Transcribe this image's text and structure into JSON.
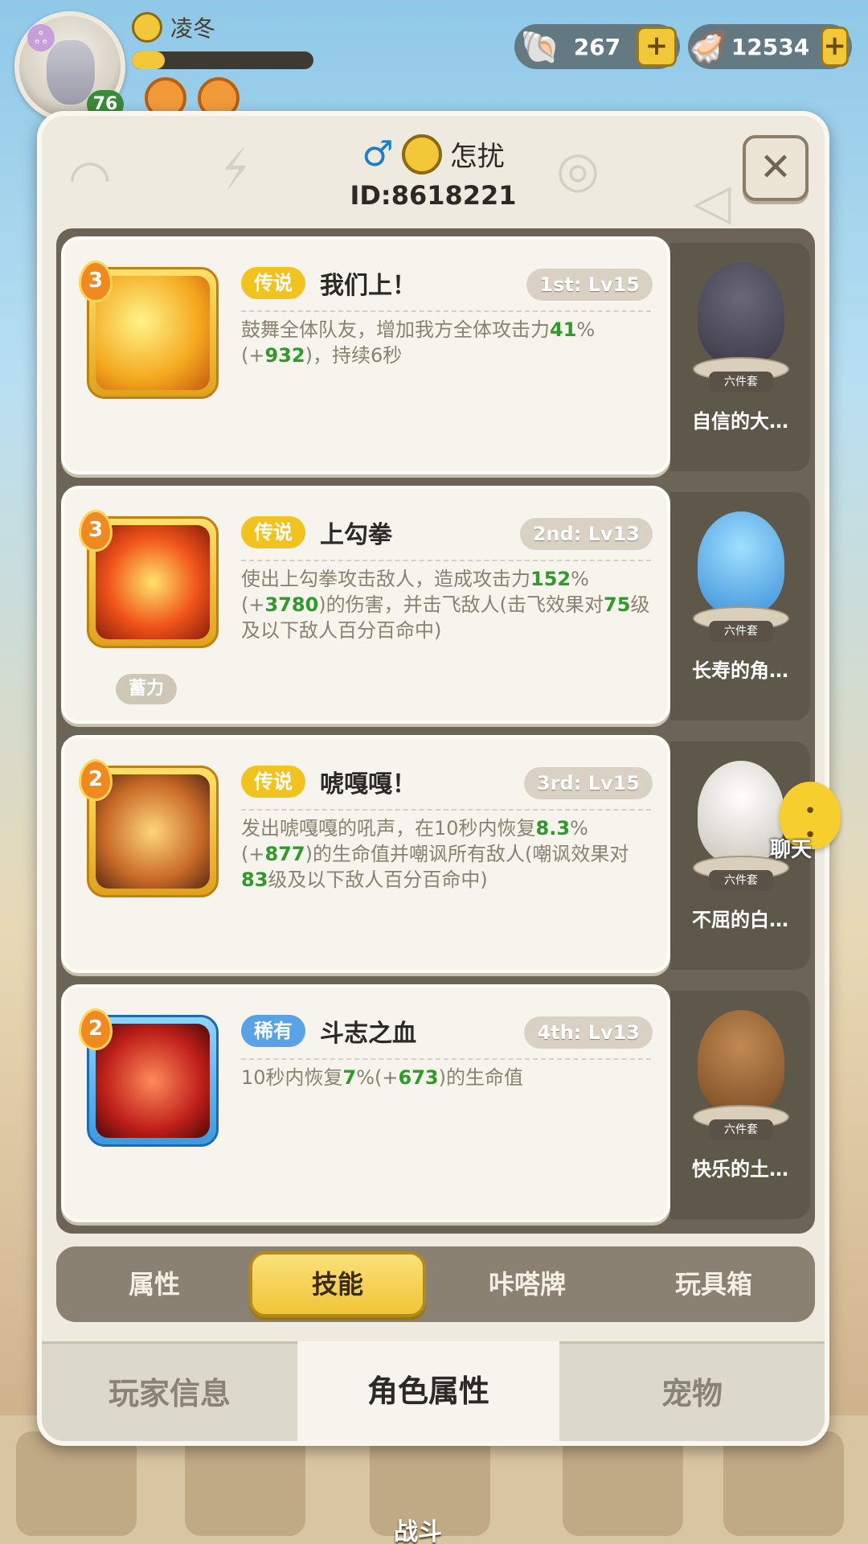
{
  "hud": {
    "player_name": "凌冬",
    "level": "76",
    "currency1": "267",
    "currency2": "12534",
    "plus_label": "+",
    "exp_progress": 0.18
  },
  "bottom_nav": {
    "battle_label": "战斗"
  },
  "dialog": {
    "title_name": "怎扰",
    "player_id": "ID:8618221",
    "close_label": "✕",
    "gender_icon": "male-icon"
  },
  "skills": [
    {
      "rank": "3",
      "rarity": "传说",
      "rarity_type": "legend",
      "name": "我们上！",
      "slot": "1st: Lv15",
      "desc": [
        "鼓舞全体队友，增加我方全体攻击力",
        "41",
        "%(+",
        "932",
        ")，持续6秒"
      ],
      "charge": "",
      "pet_name": "自信的大…",
      "pet_set": "六件套"
    },
    {
      "rank": "3",
      "rarity": "传说",
      "rarity_type": "legend",
      "name": "上勾拳",
      "slot": "2nd: Lv13",
      "desc": [
        "使出上勾拳攻击敌人，造成攻击力",
        "152",
        "%(+",
        "3780",
        ")的伤害，并击飞敌人(击飞效果对",
        "75",
        "级及以下敌人百分百命中)"
      ],
      "charge": "蓄力",
      "pet_name": "长寿的角…",
      "pet_set": "六件套"
    },
    {
      "rank": "2",
      "rarity": "传说",
      "rarity_type": "legend",
      "name": "唬嘎嘎！",
      "slot": "3rd: Lv15",
      "desc": [
        "发出唬嘎嘎的吼声，在10秒内恢复",
        "8.3",
        "%(+",
        "877",
        ")的生命值并嘲讽所有敌人(嘲讽效果对",
        "83",
        "级及以下敌人百分百命中)"
      ],
      "charge": "",
      "pet_name": "不屈的白…",
      "pet_set": "六件套"
    },
    {
      "rank": "2",
      "rarity": "稀有",
      "rarity_type": "rare",
      "name": "斗志之血",
      "slot": "4th: Lv13",
      "desc": [
        "10秒内恢复",
        "7",
        "%(+",
        "673",
        ")的生命值"
      ],
      "charge": "",
      "pet_name": "快乐的土…",
      "pet_set": "六件套"
    }
  ],
  "chat": {
    "label": "聊天"
  },
  "sub_tabs": [
    "属性",
    "技能",
    "咔嗒牌",
    "玩具箱"
  ],
  "sub_tab_active": 1,
  "main_tabs": [
    "玩家信息",
    "角色属性",
    "宠物"
  ],
  "main_tab_active": 1
}
